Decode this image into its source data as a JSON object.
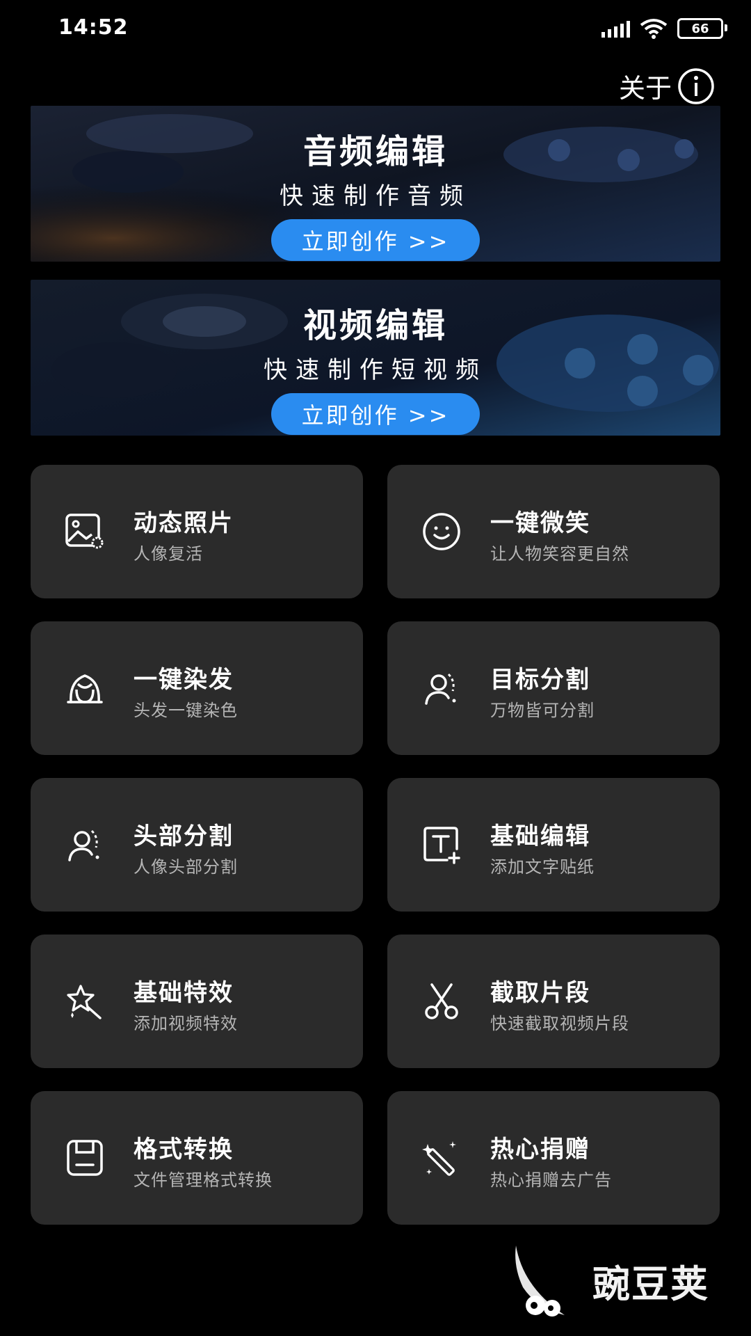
{
  "status": {
    "time": "14:52",
    "battery": "66"
  },
  "header": {
    "about_label": "关于"
  },
  "banners": [
    {
      "title": "音频编辑",
      "subtitle": "快速制作音频",
      "button": "立即创作 >>"
    },
    {
      "title": "视频编辑",
      "subtitle": "快速制作短视频",
      "button": "立即创作 >>"
    }
  ],
  "features": [
    {
      "title": "动态照片",
      "subtitle": "人像复活",
      "icon": "photo-icon"
    },
    {
      "title": "一键微笑",
      "subtitle": "让人物笑容更自然",
      "icon": "smile-icon"
    },
    {
      "title": "一键染发",
      "subtitle": "头发一键染色",
      "icon": "hair-icon"
    },
    {
      "title": "目标分割",
      "subtitle": "万物皆可分割",
      "icon": "person-segment-icon"
    },
    {
      "title": "头部分割",
      "subtitle": "人像头部分割",
      "icon": "head-segment-icon"
    },
    {
      "title": "基础编辑",
      "subtitle": "添加文字贴纸",
      "icon": "text-add-icon"
    },
    {
      "title": "基础特效",
      "subtitle": "添加视频特效",
      "icon": "magic-star-icon"
    },
    {
      "title": "截取片段",
      "subtitle": "快速截取视频片段",
      "icon": "scissors-icon"
    },
    {
      "title": "格式转换",
      "subtitle": "文件管理格式转换",
      "icon": "save-icon"
    },
    {
      "title": "热心捐赠",
      "subtitle": "热心捐赠去广告",
      "icon": "magic-wand-icon"
    }
  ],
  "watermark": {
    "text": "豌豆荚"
  }
}
